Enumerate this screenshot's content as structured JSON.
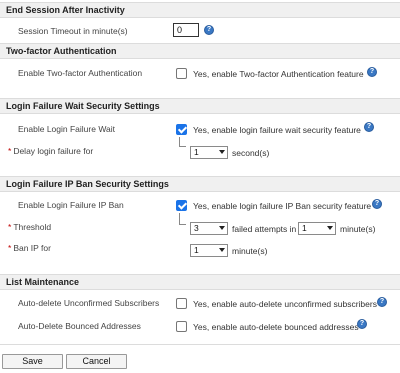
{
  "sections": {
    "session": {
      "title": "End Session After Inactivity",
      "timeout_label": "Session Timeout in minute(s)",
      "timeout_value": "0"
    },
    "two_factor": {
      "title": "Two-factor Authentication",
      "enable_label": "Enable Two-factor Authentication",
      "enable_text": "Yes, enable Two-factor Authentication feature",
      "enabled": false
    },
    "login_wait": {
      "title": "Login Failure Wait Security Settings",
      "enable_label": "Enable Login Failure Wait",
      "enable_text": "Yes, enable login failure wait security feature",
      "enabled": true,
      "required_mark": "*",
      "delay_label": "Delay login failure for",
      "delay_value": "1",
      "delay_unit": "second(s)"
    },
    "ip_ban": {
      "title": "Login Failure IP Ban Security Settings",
      "enable_label": "Enable Login Failure IP Ban",
      "enable_text": "Yes, enable login failure IP Ban security feature",
      "enabled": true,
      "required_mark": "*",
      "threshold_label": "Threshold",
      "threshold_value": "3",
      "threshold_text": "failed attempts in",
      "threshold_minutes_value": "1",
      "threshold_minutes_unit": "minute(s)",
      "ban_label": "Ban IP for",
      "ban_value": "1",
      "ban_unit": "minute(s)"
    },
    "list_maintenance": {
      "title": "List Maintenance",
      "unconfirmed_label": "Auto-delete Unconfirmed Subscribers",
      "unconfirmed_text": "Yes, enable auto-delete unconfirmed subscribers",
      "unconfirmed_enabled": false,
      "bounced_label": "Auto-Delete Bounced Addresses",
      "bounced_text": "Yes, enable auto-delete bounced addresses",
      "bounced_enabled": false
    }
  },
  "buttons": {
    "save": "Save",
    "cancel": "Cancel"
  },
  "icons": {
    "help": "help-icon",
    "help_glyph": "?"
  },
  "colors": {
    "accent": "#1a73e8",
    "required": "#c00000",
    "header_bg": "#f0f0f0"
  }
}
